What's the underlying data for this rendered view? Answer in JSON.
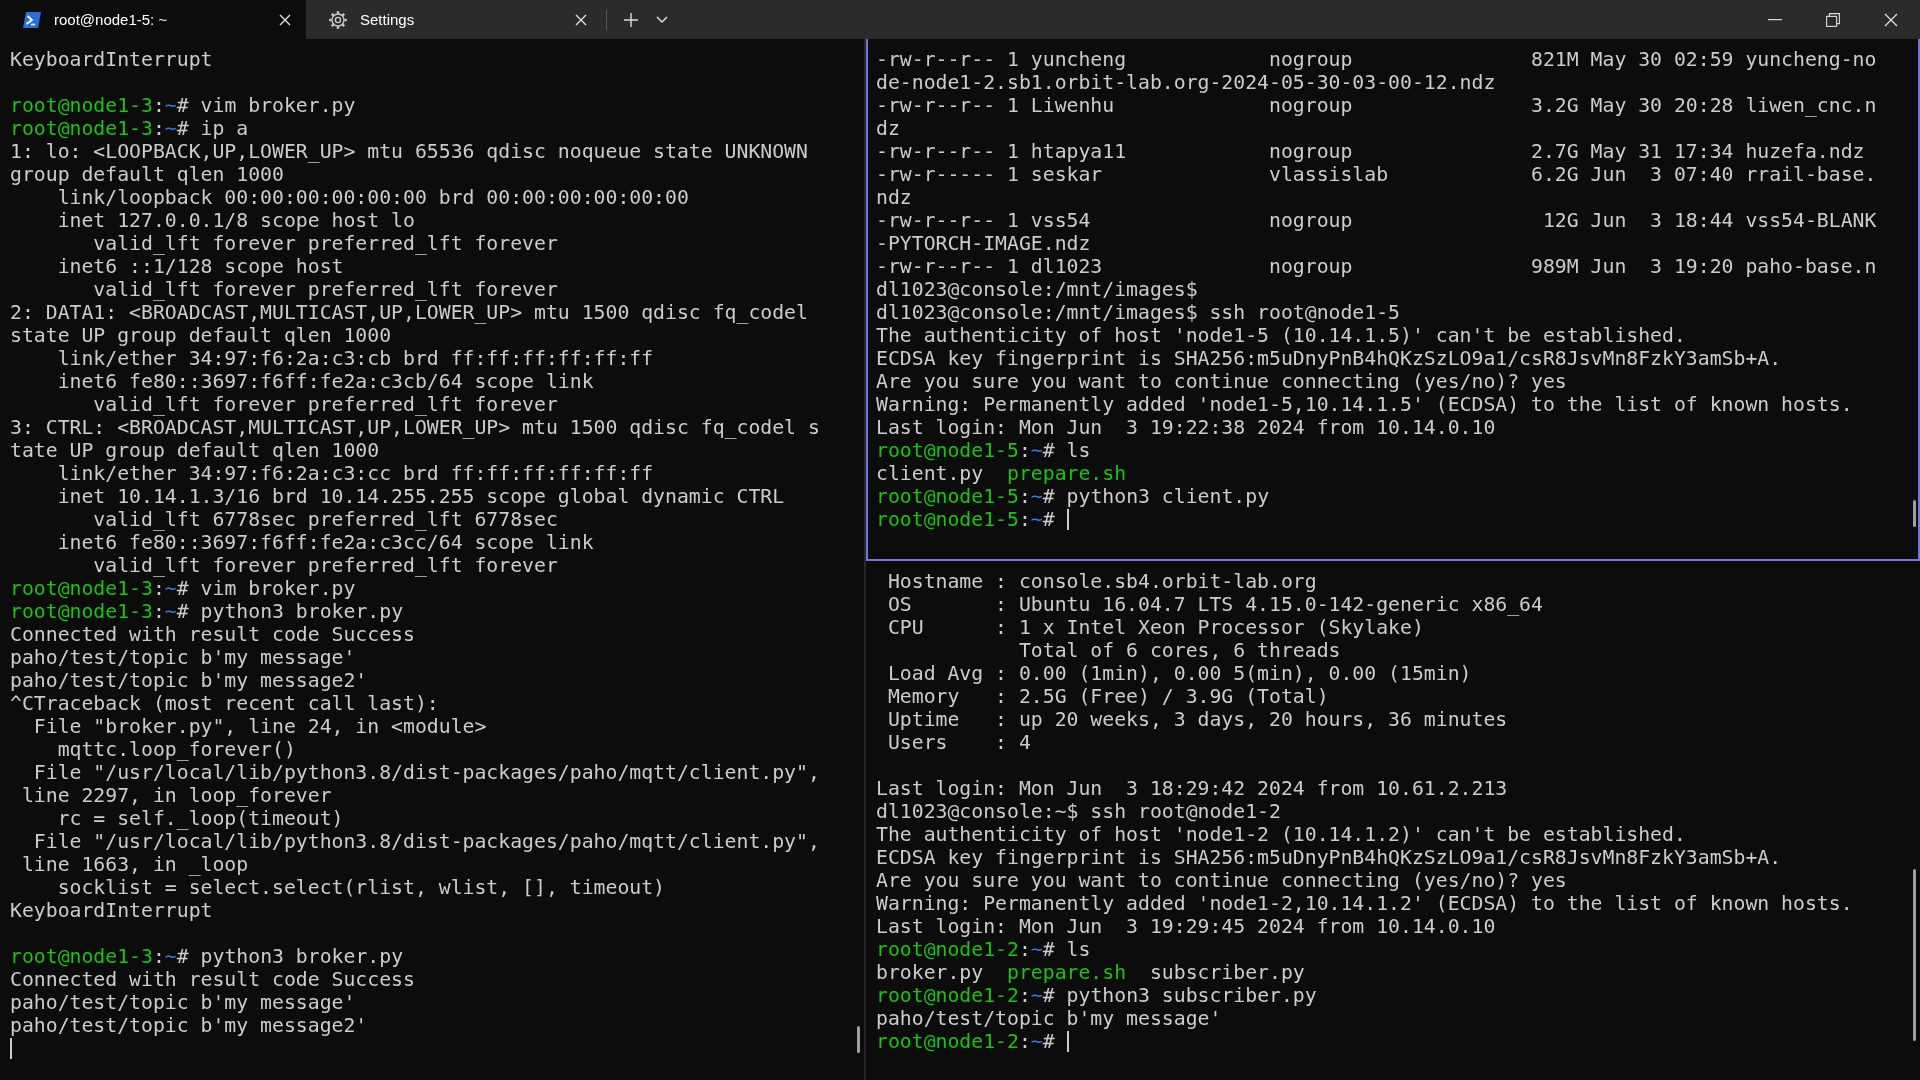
{
  "tabs": [
    {
      "kind": "shell",
      "title": "root@node1-5: ~",
      "selected": true
    },
    {
      "kind": "settings",
      "title": "Settings",
      "selected": false
    }
  ],
  "left_pane": {
    "focused": false,
    "lines": [
      {
        "kind": "text",
        "text": "KeyboardInterrupt"
      },
      {
        "kind": "blank"
      },
      {
        "kind": "prompt",
        "user": "root@node1-3",
        "separator": ":",
        "path": "~",
        "symbol": "#",
        "command": "vim broker.py",
        "cursor": false
      },
      {
        "kind": "prompt",
        "user": "root@node1-3",
        "separator": ":",
        "path": "~",
        "symbol": "#",
        "command": "ip a",
        "cursor": false
      },
      {
        "kind": "text",
        "text": "1: lo: <LOOPBACK,UP,LOWER_UP> mtu 65536 qdisc noqueue state UNKNOWN"
      },
      {
        "kind": "text",
        "text": "group default qlen 1000"
      },
      {
        "kind": "text",
        "text": "    link/loopback 00:00:00:00:00:00 brd 00:00:00:00:00:00"
      },
      {
        "kind": "text",
        "text": "    inet 127.0.0.1/8 scope host lo"
      },
      {
        "kind": "text",
        "text": "       valid_lft forever preferred_lft forever"
      },
      {
        "kind": "text",
        "text": "    inet6 ::1/128 scope host"
      },
      {
        "kind": "text",
        "text": "       valid_lft forever preferred_lft forever"
      },
      {
        "kind": "text",
        "text": "2: DATA1: <BROADCAST,MULTICAST,UP,LOWER_UP> mtu 1500 qdisc fq_codel"
      },
      {
        "kind": "text",
        "text": "state UP group default qlen 1000"
      },
      {
        "kind": "text",
        "text": "    link/ether 34:97:f6:2a:c3:cb brd ff:ff:ff:ff:ff:ff"
      },
      {
        "kind": "text",
        "text": "    inet6 fe80::3697:f6ff:fe2a:c3cb/64 scope link"
      },
      {
        "kind": "text",
        "text": "       valid_lft forever preferred_lft forever"
      },
      {
        "kind": "text",
        "text": "3: CTRL: <BROADCAST,MULTICAST,UP,LOWER_UP> mtu 1500 qdisc fq_codel s"
      },
      {
        "kind": "text",
        "text": "tate UP group default qlen 1000"
      },
      {
        "kind": "text",
        "text": "    link/ether 34:97:f6:2a:c3:cc brd ff:ff:ff:ff:ff:ff"
      },
      {
        "kind": "text",
        "text": "    inet 10.14.1.3/16 brd 10.14.255.255 scope global dynamic CTRL"
      },
      {
        "kind": "text",
        "text": "       valid_lft 6778sec preferred_lft 6778sec"
      },
      {
        "kind": "text",
        "text": "    inet6 fe80::3697:f6ff:fe2a:c3cc/64 scope link"
      },
      {
        "kind": "text",
        "text": "       valid_lft forever preferred_lft forever"
      },
      {
        "kind": "prompt",
        "user": "root@node1-3",
        "separator": ":",
        "path": "~",
        "symbol": "#",
        "command": "vim broker.py",
        "cursor": false
      },
      {
        "kind": "prompt",
        "user": "root@node1-3",
        "separator": ":",
        "path": "~",
        "symbol": "#",
        "command": "python3 broker.py",
        "cursor": false
      },
      {
        "kind": "text",
        "text": "Connected with result code Success"
      },
      {
        "kind": "text",
        "text": "paho/test/topic b'my message'"
      },
      {
        "kind": "text",
        "text": "paho/test/topic b'my message2'"
      },
      {
        "kind": "text",
        "text": "^CTraceback (most recent call last):"
      },
      {
        "kind": "text",
        "text": "  File \"broker.py\", line 24, in <module>"
      },
      {
        "kind": "text",
        "text": "    mqttc.loop_forever()"
      },
      {
        "kind": "text",
        "text": "  File \"/usr/local/lib/python3.8/dist-packages/paho/mqtt/client.py\","
      },
      {
        "kind": "text",
        "text": " line 2297, in loop_forever"
      },
      {
        "kind": "text",
        "text": "    rc = self._loop(timeout)"
      },
      {
        "kind": "text",
        "text": "  File \"/usr/local/lib/python3.8/dist-packages/paho/mqtt/client.py\","
      },
      {
        "kind": "text",
        "text": " line 1663, in _loop"
      },
      {
        "kind": "text",
        "text": "    socklist = select.select(rlist, wlist, [], timeout)"
      },
      {
        "kind": "text",
        "text": "KeyboardInterrupt"
      },
      {
        "kind": "blank"
      },
      {
        "kind": "prompt",
        "user": "root@node1-3",
        "separator": ":",
        "path": "~",
        "symbol": "#",
        "command": "python3 broker.py",
        "cursor": false
      },
      {
        "kind": "text",
        "text": "Connected with result code Success"
      },
      {
        "kind": "text",
        "text": "paho/test/topic b'my message'"
      },
      {
        "kind": "text",
        "text": "paho/test/topic b'my message2'"
      },
      {
        "kind": "cursor"
      }
    ]
  },
  "right_top_pane": {
    "focused": true,
    "lines": [
      {
        "kind": "text",
        "text": "-rw-r--r-- 1 yuncheng            nogroup               821M May 30 02:59 yuncheng-no"
      },
      {
        "kind": "text",
        "text": "de-node1-2.sb1.orbit-lab.org-2024-05-30-03-00-12.ndz"
      },
      {
        "kind": "text",
        "text": "-rw-r--r-- 1 Liwenhu             nogroup               3.2G May 30 20:28 liwen_cnc.n"
      },
      {
        "kind": "text",
        "text": "dz"
      },
      {
        "kind": "text",
        "text": "-rw-r--r-- 1 htapya11            nogroup               2.7G May 31 17:34 huzefa.ndz"
      },
      {
        "kind": "text",
        "text": "-rw-r----- 1 seskar              vlassislab            6.2G Jun  3 07:40 rrail-base."
      },
      {
        "kind": "text",
        "text": "ndz"
      },
      {
        "kind": "text",
        "text": "-rw-r--r-- 1 vss54               nogroup                12G Jun  3 18:44 vss54-BLANK"
      },
      {
        "kind": "text",
        "text": "-PYTORCH-IMAGE.ndz"
      },
      {
        "kind": "text",
        "text": "-rw-r--r-- 1 dl1023              nogroup               989M Jun  3 19:20 paho-base.n"
      },
      {
        "kind": "text",
        "text": "dl1023@console:/mnt/images$"
      },
      {
        "kind": "text",
        "text": "dl1023@console:/mnt/images$ ssh root@node1-5"
      },
      {
        "kind": "text",
        "text": "The authenticity of host 'node1-5 (10.14.1.5)' can't be established."
      },
      {
        "kind": "text",
        "text": "ECDSA key fingerprint is SHA256:m5uDnyPnB4hQKzSzLO9a1/csR8JsvMn8FzkY3amSb+A."
      },
      {
        "kind": "text",
        "text": "Are you sure you want to continue connecting (yes/no)? yes"
      },
      {
        "kind": "text",
        "text": "Warning: Permanently added 'node1-5,10.14.1.5' (ECDSA) to the list of known hosts."
      },
      {
        "kind": "text",
        "text": "Last login: Mon Jun  3 19:22:38 2024 from 10.14.0.10"
      },
      {
        "kind": "prompt",
        "user": "root@node1-5",
        "separator": ":",
        "path": "~",
        "symbol": "#",
        "command": "ls",
        "cursor": false
      },
      {
        "kind": "listing",
        "files": [
          {
            "name": "client.py",
            "executable": false
          },
          {
            "name": "prepare.sh",
            "executable": true
          }
        ]
      },
      {
        "kind": "prompt",
        "user": "root@node1-5",
        "separator": ":",
        "path": "~",
        "symbol": "#",
        "command": "python3 client.py",
        "cursor": false
      },
      {
        "kind": "prompt",
        "user": "root@node1-5",
        "separator": ":",
        "path": "~",
        "symbol": "#",
        "cursor": true
      }
    ]
  },
  "right_bottom_pane": {
    "focused": false,
    "lines": [
      {
        "kind": "text",
        "text": " Hostname : console.sb4.orbit-lab.org"
      },
      {
        "kind": "text",
        "text": " OS       : Ubuntu 16.04.7 LTS 4.15.0-142-generic x86_64"
      },
      {
        "kind": "text",
        "text": " CPU      : 1 x Intel Xeon Processor (Skylake)"
      },
      {
        "kind": "text",
        "text": "            Total of 6 cores, 6 threads"
      },
      {
        "kind": "text",
        "text": " Load Avg : 0.00 (1min), 0.00 5(min), 0.00 (15min)"
      },
      {
        "kind": "text",
        "text": " Memory   : 2.5G (Free) / 3.9G (Total)"
      },
      {
        "kind": "text",
        "text": " Uptime   : up 20 weeks, 3 days, 20 hours, 36 minutes"
      },
      {
        "kind": "text",
        "text": " Users    : 4"
      },
      {
        "kind": "blank"
      },
      {
        "kind": "text",
        "text": "Last login: Mon Jun  3 18:29:42 2024 from 10.61.2.213"
      },
      {
        "kind": "text",
        "text": "dl1023@console:~$ ssh root@node1-2"
      },
      {
        "kind": "text",
        "text": "The authenticity of host 'node1-2 (10.14.1.2)' can't be established."
      },
      {
        "kind": "text",
        "text": "ECDSA key fingerprint is SHA256:m5uDnyPnB4hQKzSzLO9a1/csR8JsvMn8FzkY3amSb+A."
      },
      {
        "kind": "text",
        "text": "Are you sure you want to continue connecting (yes/no)? yes"
      },
      {
        "kind": "text",
        "text": "Warning: Permanently added 'node1-2,10.14.1.2' (ECDSA) to the list of known hosts."
      },
      {
        "kind": "text",
        "text": "Last login: Mon Jun  3 19:29:45 2024 from 10.14.0.10"
      },
      {
        "kind": "prompt",
        "user": "root@node1-2",
        "separator": ":",
        "path": "~",
        "symbol": "#",
        "command": "ls",
        "cursor": false
      },
      {
        "kind": "listing",
        "files": [
          {
            "name": "broker.py",
            "executable": false
          },
          {
            "name": "prepare.sh",
            "executable": true
          },
          {
            "name": "subscriber.py",
            "executable": false
          }
        ]
      },
      {
        "kind": "prompt",
        "user": "root@node1-2",
        "separator": ":",
        "path": "~",
        "symbol": "#",
        "command": "python3 subscriber.py",
        "cursor": false
      },
      {
        "kind": "text",
        "text": "paho/test/topic b'my message'"
      },
      {
        "kind": "prompt",
        "user": "root@node1-2",
        "separator": ":",
        "path": "~",
        "symbol": "#",
        "cursor": true
      }
    ]
  }
}
